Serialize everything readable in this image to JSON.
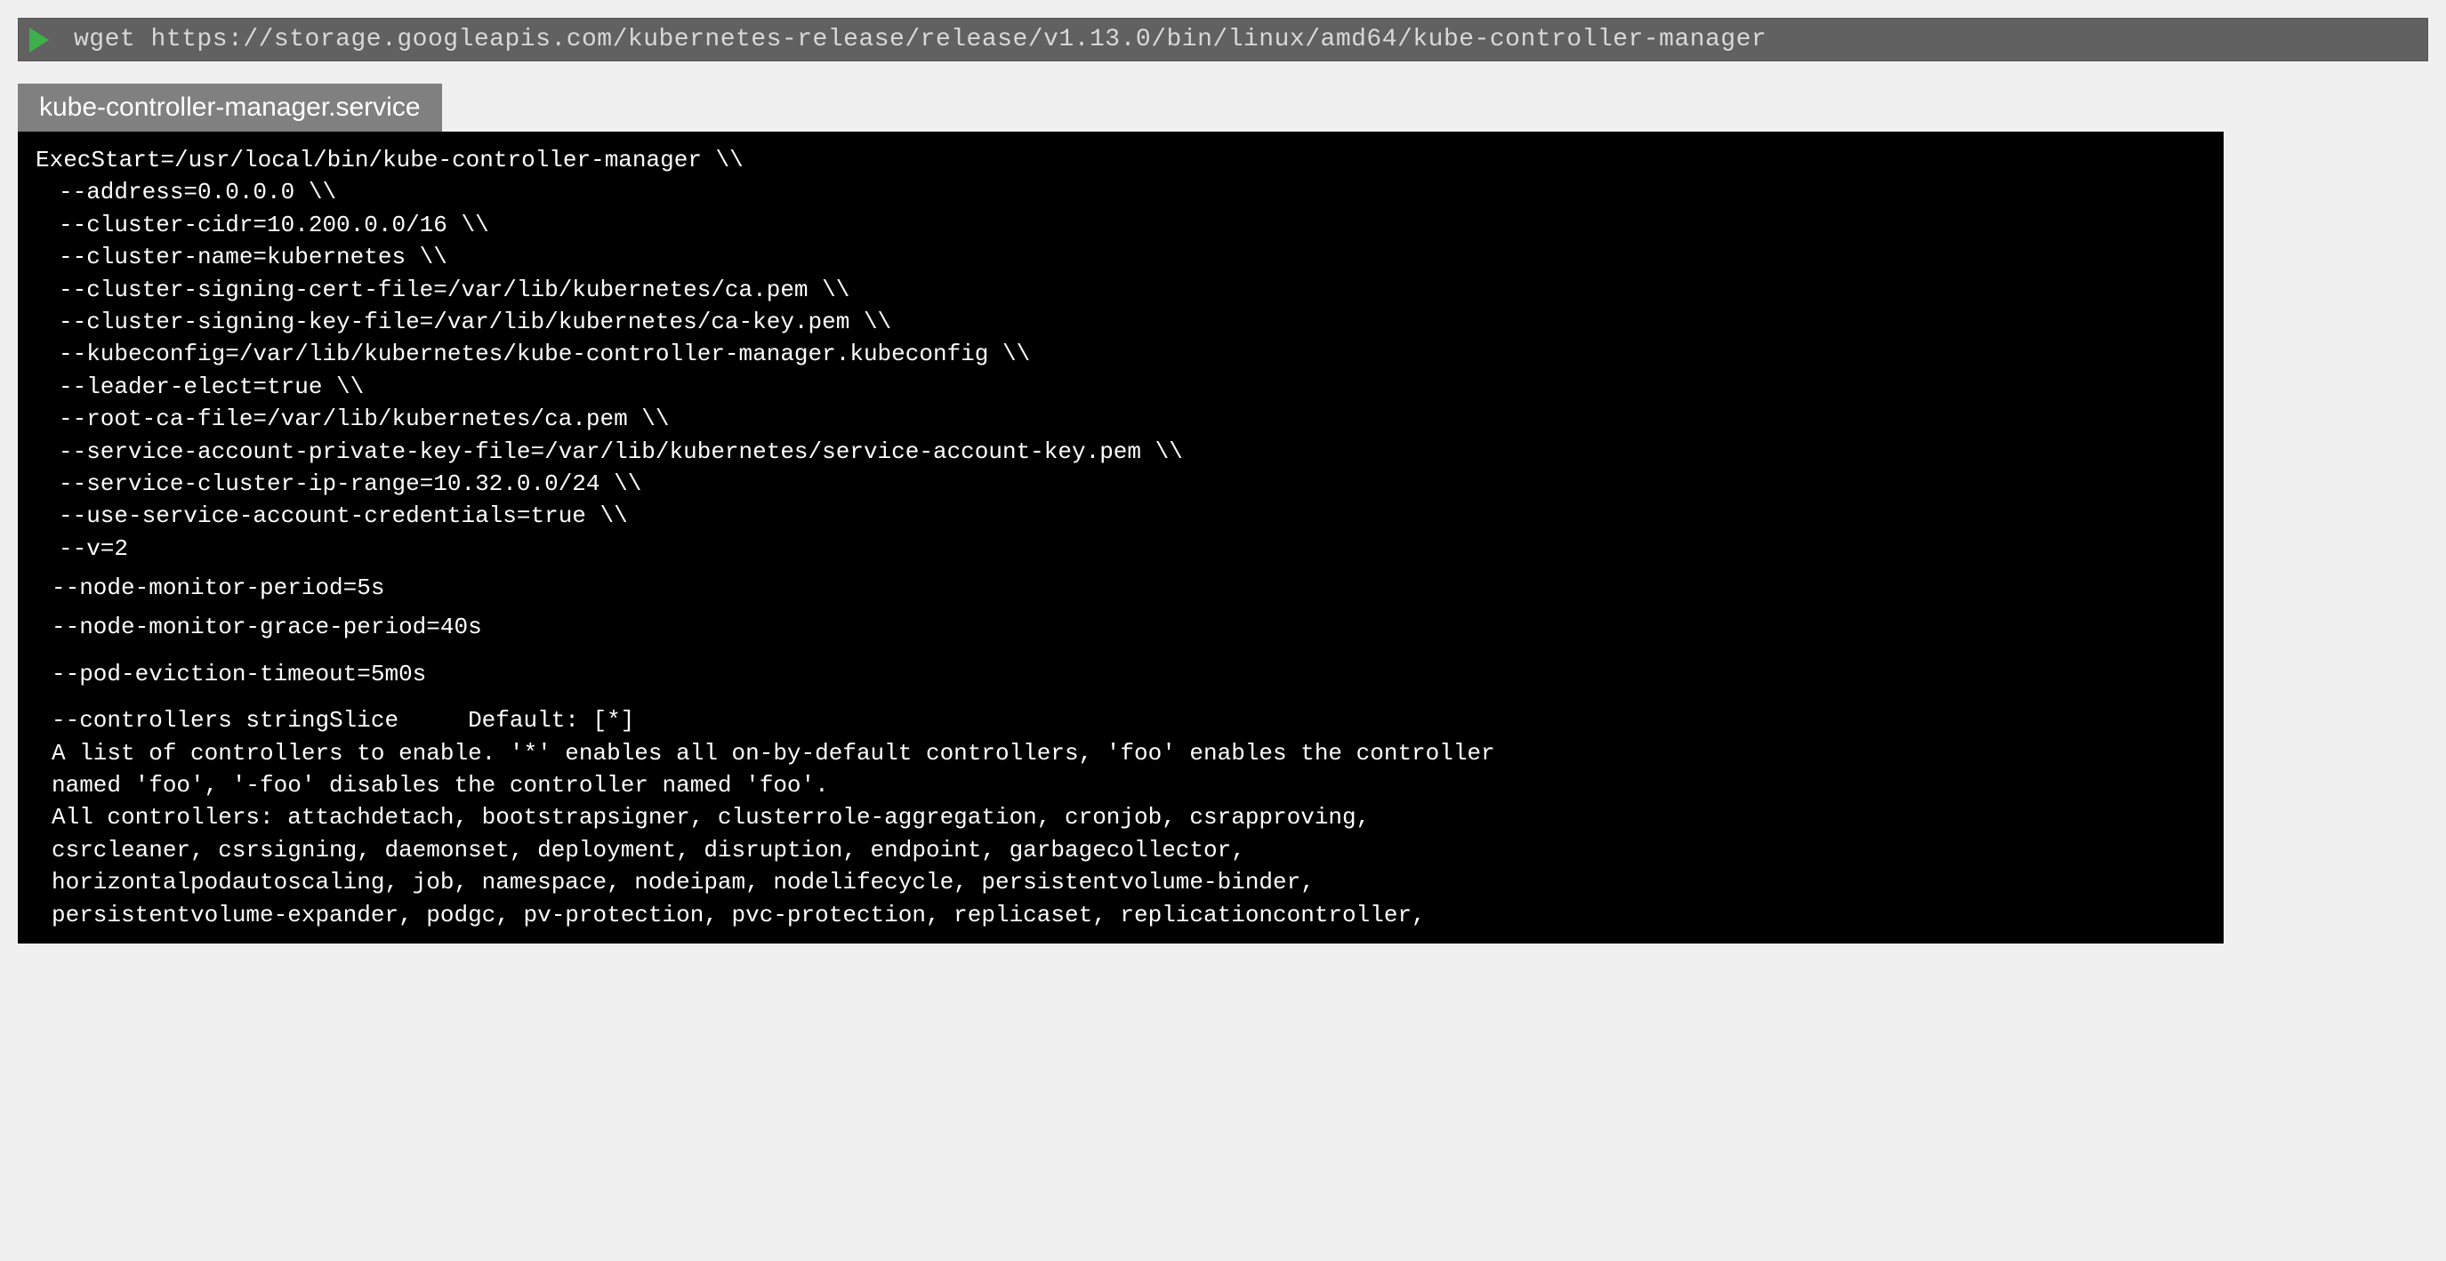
{
  "command_bar": {
    "command": "wget https://storage.googleapis.com/kubernetes-release/release/v1.13.0/bin/linux/amd64/kube-controller-manager"
  },
  "tab": {
    "title": "kube-controller-manager.service"
  },
  "code": {
    "line1": "ExecStart=/usr/local/bin/kube-controller-manager \\\\",
    "line2": "--address=0.0.0.0 \\\\",
    "line3": "--cluster-cidr=10.200.0.0/16 \\\\",
    "line4": "--cluster-name=kubernetes \\\\",
    "line5": "--cluster-signing-cert-file=/var/lib/kubernetes/ca.pem \\\\",
    "line6": "--cluster-signing-key-file=/var/lib/kubernetes/ca-key.pem \\\\",
    "line7": "--kubeconfig=/var/lib/kubernetes/kube-controller-manager.kubeconfig \\\\",
    "line8": "--leader-elect=true \\\\",
    "line9": "--root-ca-file=/var/lib/kubernetes/ca.pem \\\\",
    "line10": "--service-account-private-key-file=/var/lib/kubernetes/service-account-key.pem \\\\",
    "line11": "--service-cluster-ip-range=10.32.0.0/24 \\\\",
    "line12": "--use-service-account-credentials=true \\\\",
    "line13": "--v=2",
    "line14": "--node-monitor-period=5s",
    "line15": "--node-monitor-grace-period=40s",
    "line16": "--pod-eviction-timeout=5m0s",
    "line17": "--controllers stringSlice     Default: [*]",
    "line18": "A list of controllers to enable. '*' enables all on-by-default controllers, 'foo' enables the controller",
    "line19": "named 'foo', '-foo' disables the controller named 'foo'.",
    "line20": "All controllers: attachdetach, bootstrapsigner, clusterrole-aggregation, cronjob, csrapproving,",
    "line21": "csrcleaner, csrsigning, daemonset, deployment, disruption, endpoint, garbagecollector,",
    "line22": "horizontalpodautoscaling, job, namespace, nodeipam, nodelifecycle, persistentvolume-binder,",
    "line23": "persistentvolume-expander, podgc, pv-protection, pvc-protection, replicaset, replicationcontroller,"
  }
}
